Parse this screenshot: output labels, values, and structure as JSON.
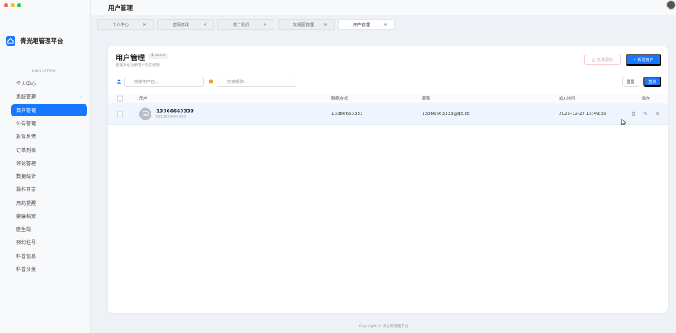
{
  "app": {
    "brand_name": "青光眼管理平台",
    "page_title": "用户管理"
  },
  "colors": {
    "accent": "#1677ff",
    "traffic_red": "#ff5f57",
    "traffic_yellow": "#febc2e",
    "traffic_green": "#28c840"
  },
  "sidebar": {
    "section_label": "NAVIGATION",
    "items": [
      {
        "label": "个人中心"
      },
      {
        "label": "系统管理",
        "chevron": "›"
      },
      {
        "label": "用户管理",
        "active": true
      },
      {
        "label": "公告管理"
      },
      {
        "label": "投诉反馈"
      },
      {
        "label": "订单列表"
      },
      {
        "label": "评论管理"
      },
      {
        "label": "数据统计"
      },
      {
        "label": "操作日志"
      },
      {
        "label": "用药提醒"
      },
      {
        "label": "健康档案"
      },
      {
        "label": "医生端"
      },
      {
        "label": "预约挂号"
      },
      {
        "label": "科普信息"
      },
      {
        "label": "科普分类"
      }
    ]
  },
  "tabs": [
    {
      "label": "个人中心"
    },
    {
      "label": "密码修改"
    },
    {
      "label": "关于我们"
    },
    {
      "label": "轮播图管理"
    },
    {
      "label": "用户管理",
      "active": true
    }
  ],
  "card": {
    "title": "用户管理",
    "badge": "1 users",
    "subtitle": "管理系统注册用户及其权限",
    "batch_delete_label": "批量删除",
    "add_user_label": "新增用户",
    "add_icon": "+",
    "delete_icon": "trash-icon"
  },
  "search": {
    "username_placeholder": "搜索用户名...",
    "nickname_placeholder": "搜索昵称...",
    "reset_label": "重置",
    "query_label": "查询"
  },
  "table": {
    "headers": {
      "user": "用户",
      "phone": "联系方式",
      "email": "邮箱",
      "joined": "加入时间",
      "actions": "操作"
    },
    "rows": [
      {
        "username": "13366663333",
        "uid": "ID13366663333",
        "phone": "13366663333",
        "email": "13366663333@qq.cc",
        "joined": "2025-12-27 15:49:36"
      }
    ],
    "action_icons": {
      "lock": "🔒",
      "edit": "✎",
      "delete": "×"
    }
  },
  "footer": {
    "copyright": "Copyright © 青光眼管理平台"
  }
}
